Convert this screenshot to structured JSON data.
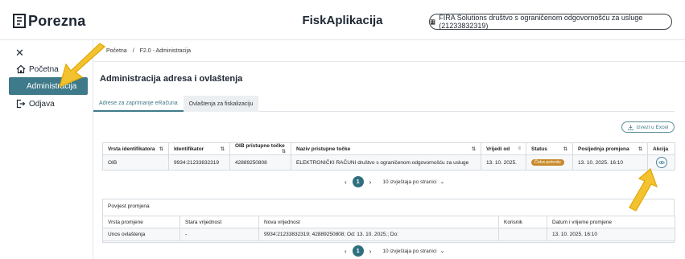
{
  "header": {
    "logo": "Porezna",
    "app_title": "FiskAplikacija",
    "company": "FIRA Solutions društvo s ograničenom odgovornošću za usluge (21233832319)"
  },
  "sidebar": {
    "close_icon": "close-icon",
    "items": [
      {
        "label": "Početna",
        "icon": "home-icon",
        "active": false
      },
      {
        "label": "Administracija",
        "icon": "",
        "active": true
      },
      {
        "label": "Odjava",
        "icon": "logout-icon",
        "active": false
      }
    ]
  },
  "breadcrumb": {
    "home": "Početna",
    "separator": "/",
    "current": "F2.0 - Administracija"
  },
  "main": {
    "title": "Administracija adresa i ovlaštenja",
    "tabs": [
      {
        "label": "Adrese za zaprimanje eRačuna",
        "active": true
      },
      {
        "label": "Ovlaštenja za fiskalizaciju",
        "active": false
      }
    ],
    "export_label": "Izvezi u Excel"
  },
  "addresses_table": {
    "columns": [
      "Vrsta identifikatora",
      "Identifikator",
      "OIB pristupne točke",
      "Naziv pristupne točke",
      "Vrijedi od",
      "Status",
      "Posljednja promjena",
      "Akcija"
    ],
    "rows": [
      {
        "vrsta": "OIB",
        "identifikator": "9934:21233832319",
        "oib_pt": "42889250808",
        "naziv_pt": "ELEKTRONIČKI RAČUNI društvo s ograničenom odgovornošću za usluge",
        "vrijedi_od": "13. 10. 2025.",
        "status": "Čeka potvrdu",
        "posljednja": "13. 10. 2025. 16:10"
      }
    ],
    "pager": {
      "page": "1",
      "per_page": "10 izvještaja po stranici"
    }
  },
  "history": {
    "title": "Povijest promjena",
    "columns": [
      "Vrsta promjene",
      "Stara vrijednost",
      "Nova vrijednost",
      "Korisnik",
      "Datum i vrijeme promjene"
    ],
    "rows": [
      {
        "vrsta": "Unos ovlaštenja",
        "stara": "-",
        "nova": "9934:21233832319; 42889250808; Od: 13. 10. 2025.; Do:",
        "korisnik": "",
        "datum": "13. 10. 2025. 16:10"
      }
    ],
    "pager": {
      "page": "1",
      "per_page": "10 izvještaja po stranici"
    }
  },
  "colors": {
    "accent": "#3f7a8a",
    "badge": "#c98a2c",
    "arrow": "#f2c230"
  }
}
